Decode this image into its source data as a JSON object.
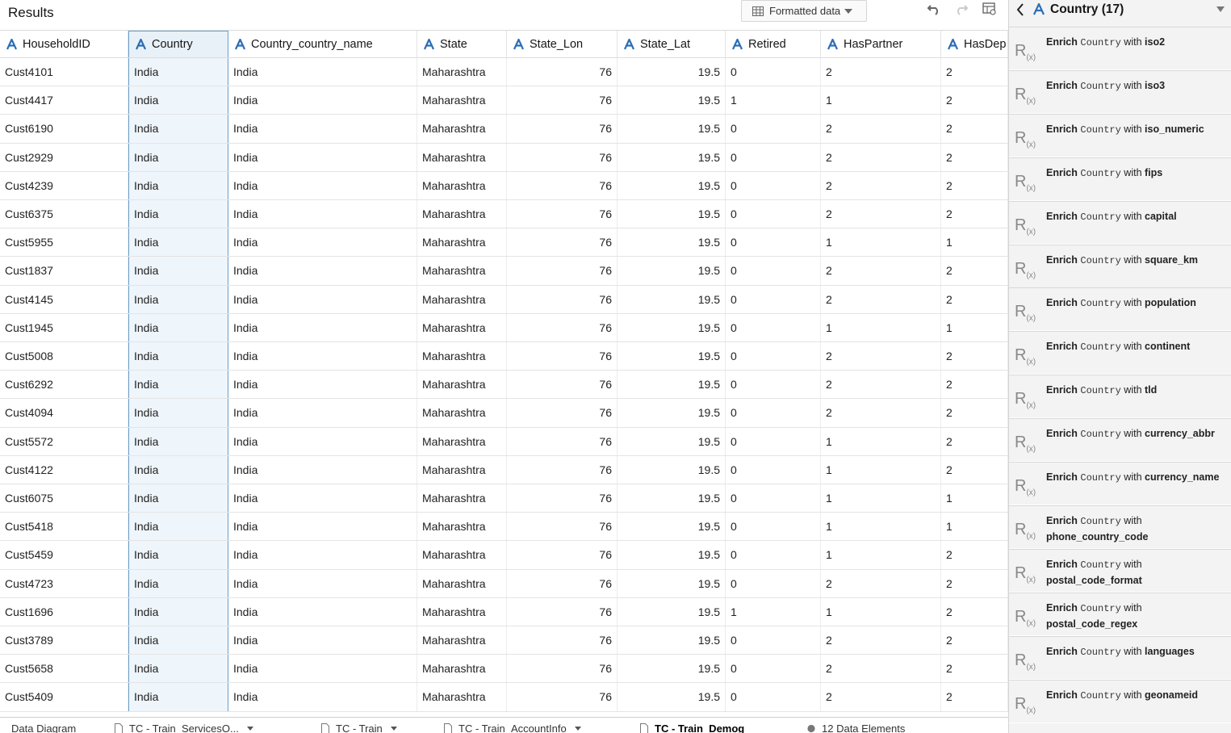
{
  "results": {
    "title": "Results",
    "format_dropdown": "Formatted data",
    "columns": [
      "HouseholdID",
      "Country",
      "Country_country_name",
      "State",
      "State_Lon",
      "State_Lat",
      "Retired",
      "HasPartner",
      "HasDep"
    ],
    "rows": [
      [
        "Cust4101",
        "India",
        "India",
        "Maharashtra",
        "76",
        "19.5",
        "0",
        "2",
        "2"
      ],
      [
        "Cust4417",
        "India",
        "India",
        "Maharashtra",
        "76",
        "19.5",
        "1",
        "1",
        "2"
      ],
      [
        "Cust6190",
        "India",
        "India",
        "Maharashtra",
        "76",
        "19.5",
        "0",
        "2",
        "2"
      ],
      [
        "Cust2929",
        "India",
        "India",
        "Maharashtra",
        "76",
        "19.5",
        "0",
        "2",
        "2"
      ],
      [
        "Cust4239",
        "India",
        "India",
        "Maharashtra",
        "76",
        "19.5",
        "0",
        "2",
        "2"
      ],
      [
        "Cust6375",
        "India",
        "India",
        "Maharashtra",
        "76",
        "19.5",
        "0",
        "2",
        "2"
      ],
      [
        "Cust5955",
        "India",
        "India",
        "Maharashtra",
        "76",
        "19.5",
        "0",
        "1",
        "1"
      ],
      [
        "Cust1837",
        "India",
        "India",
        "Maharashtra",
        "76",
        "19.5",
        "0",
        "2",
        "2"
      ],
      [
        "Cust4145",
        "India",
        "India",
        "Maharashtra",
        "76",
        "19.5",
        "0",
        "2",
        "2"
      ],
      [
        "Cust1945",
        "India",
        "India",
        "Maharashtra",
        "76",
        "19.5",
        "0",
        "1",
        "1"
      ],
      [
        "Cust5008",
        "India",
        "India",
        "Maharashtra",
        "76",
        "19.5",
        "0",
        "2",
        "2"
      ],
      [
        "Cust6292",
        "India",
        "India",
        "Maharashtra",
        "76",
        "19.5",
        "0",
        "2",
        "2"
      ],
      [
        "Cust4094",
        "India",
        "India",
        "Maharashtra",
        "76",
        "19.5",
        "0",
        "2",
        "2"
      ],
      [
        "Cust5572",
        "India",
        "India",
        "Maharashtra",
        "76",
        "19.5",
        "0",
        "1",
        "2"
      ],
      [
        "Cust4122",
        "India",
        "India",
        "Maharashtra",
        "76",
        "19.5",
        "0",
        "1",
        "2"
      ],
      [
        "Cust6075",
        "India",
        "India",
        "Maharashtra",
        "76",
        "19.5",
        "0",
        "1",
        "1"
      ],
      [
        "Cust5418",
        "India",
        "India",
        "Maharashtra",
        "76",
        "19.5",
        "0",
        "1",
        "1"
      ],
      [
        "Cust5459",
        "India",
        "India",
        "Maharashtra",
        "76",
        "19.5",
        "0",
        "1",
        "2"
      ],
      [
        "Cust4723",
        "India",
        "India",
        "Maharashtra",
        "76",
        "19.5",
        "0",
        "2",
        "2"
      ],
      [
        "Cust1696",
        "India",
        "India",
        "Maharashtra",
        "76",
        "19.5",
        "1",
        "1",
        "2"
      ],
      [
        "Cust3789",
        "India",
        "India",
        "Maharashtra",
        "76",
        "19.5",
        "0",
        "2",
        "2"
      ],
      [
        "Cust5658",
        "India",
        "India",
        "Maharashtra",
        "76",
        "19.5",
        "0",
        "2",
        "2"
      ],
      [
        "Cust5409",
        "India",
        "India",
        "Maharashtra",
        "76",
        "19.5",
        "0",
        "2",
        "2"
      ]
    ]
  },
  "tabs": [
    {
      "label": "Data Diagram"
    },
    {
      "label": "TC - Train_ServicesO..."
    },
    {
      "label": "TC - Train"
    },
    {
      "label": "TC - Train_AccountInfo"
    },
    {
      "label": "TC - Train_Demog"
    },
    {
      "label": "12 Data Elements"
    }
  ],
  "panel": {
    "title": "Country (17)",
    "enrich_word": "Enrich",
    "column_word": "Country",
    "with_word": "with",
    "recommendations": [
      "iso2",
      "iso3",
      "iso_numeric",
      "fips",
      "capital",
      "square_km",
      "population",
      "continent",
      "tld",
      "currency_abbr",
      "currency_name",
      "phone_country_code",
      "postal_code_format",
      "postal_code_regex",
      "languages",
      "geonameid"
    ]
  },
  "icons": {
    "column_type": "attribute-a-icon",
    "recommendation": "rx-function-icon"
  },
  "colors": {
    "accent": "#2c6eb5",
    "selected_column_bg": "#eef5fb",
    "panel_bg": "#f3f3f3"
  }
}
